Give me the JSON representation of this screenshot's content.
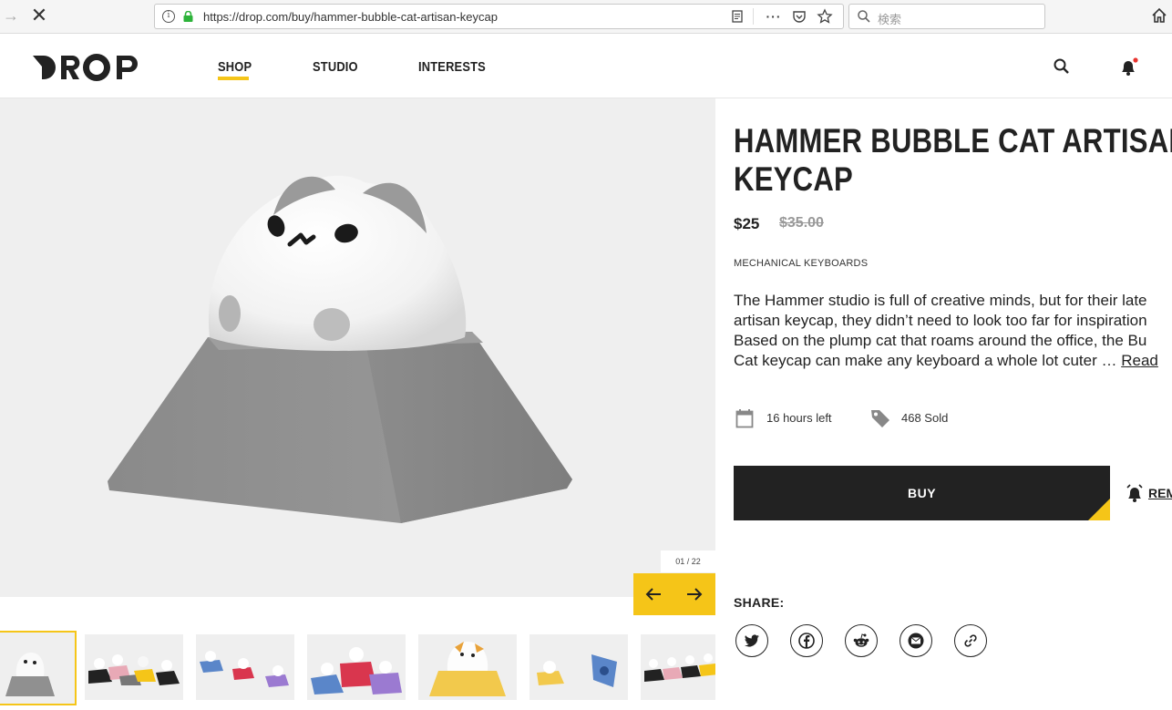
{
  "browser": {
    "url": "https://drop.com/buy/hammer-bubble-cat-artisan-keycap",
    "search_placeholder": "検索"
  },
  "header": {
    "logo_text": "DROP",
    "nav": [
      {
        "label": "SHOP",
        "active": true
      },
      {
        "label": "STUDIO",
        "active": false
      },
      {
        "label": "INTERESTS",
        "active": false
      }
    ],
    "notification_dot_color": "#e8342f"
  },
  "gallery": {
    "counter": "01 / 22",
    "thumbnails_visible": 7,
    "accent_color": "#f5c518"
  },
  "product": {
    "title_line1": "HAMMER BUBBLE CAT ARTISAN",
    "title_line2": "KEYCAP",
    "price": "$25",
    "old_price": "$35.00",
    "category": "MECHANICAL KEYBOARDS",
    "description": [
      "The Hammer studio is full of creative minds, but for their late",
      "artisan keycap, they didn’t need to look too far for inspiration",
      "Based on the plump cat that roams around the office, the Bu",
      "Cat keycap can make any keyboard a whole lot cuter … "
    ],
    "read_more": "Read",
    "time_left": "16 hours left",
    "sold": "468 Sold",
    "buy_label": "BUY",
    "remind_label": "REM",
    "share_label": "SHARE:"
  },
  "icons": [
    "back-arrow-icon",
    "stop-icon",
    "info-icon",
    "lock-icon",
    "reader-icon",
    "more-icon",
    "pocket-icon",
    "star-icon",
    "search-icon",
    "home-icon",
    "bell-icon",
    "calendar-icon",
    "tag-icon",
    "twitter-icon",
    "facebook-icon",
    "reddit-icon",
    "email-icon",
    "link-icon"
  ]
}
